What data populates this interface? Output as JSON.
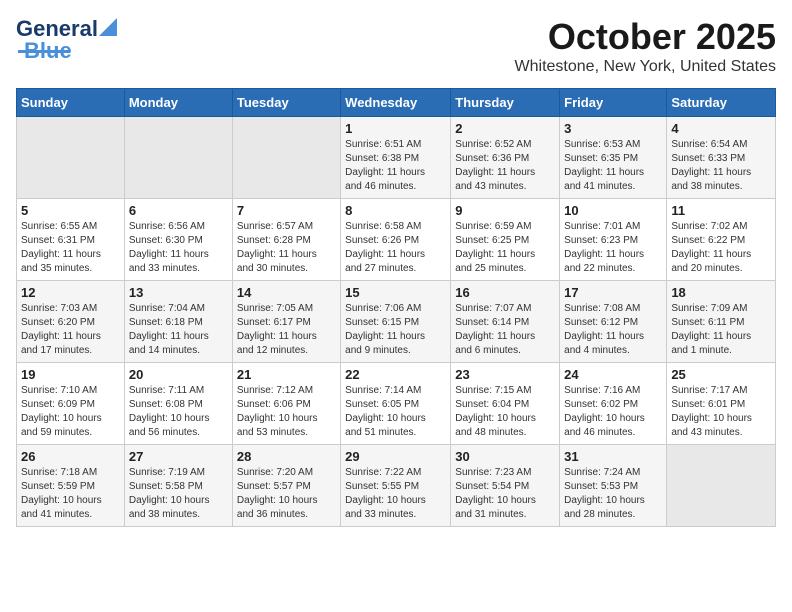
{
  "header": {
    "logo_general": "General",
    "logo_blue": "Blue",
    "month_title": "October 2025",
    "location": "Whitestone, New York, United States"
  },
  "days_of_week": [
    "Sunday",
    "Monday",
    "Tuesday",
    "Wednesday",
    "Thursday",
    "Friday",
    "Saturday"
  ],
  "weeks": [
    [
      {
        "day": "",
        "content": ""
      },
      {
        "day": "",
        "content": ""
      },
      {
        "day": "",
        "content": ""
      },
      {
        "day": "1",
        "content": "Sunrise: 6:51 AM\nSunset: 6:38 PM\nDaylight: 11 hours\nand 46 minutes."
      },
      {
        "day": "2",
        "content": "Sunrise: 6:52 AM\nSunset: 6:36 PM\nDaylight: 11 hours\nand 43 minutes."
      },
      {
        "day": "3",
        "content": "Sunrise: 6:53 AM\nSunset: 6:35 PM\nDaylight: 11 hours\nand 41 minutes."
      },
      {
        "day": "4",
        "content": "Sunrise: 6:54 AM\nSunset: 6:33 PM\nDaylight: 11 hours\nand 38 minutes."
      }
    ],
    [
      {
        "day": "5",
        "content": "Sunrise: 6:55 AM\nSunset: 6:31 PM\nDaylight: 11 hours\nand 35 minutes."
      },
      {
        "day": "6",
        "content": "Sunrise: 6:56 AM\nSunset: 6:30 PM\nDaylight: 11 hours\nand 33 minutes."
      },
      {
        "day": "7",
        "content": "Sunrise: 6:57 AM\nSunset: 6:28 PM\nDaylight: 11 hours\nand 30 minutes."
      },
      {
        "day": "8",
        "content": "Sunrise: 6:58 AM\nSunset: 6:26 PM\nDaylight: 11 hours\nand 27 minutes."
      },
      {
        "day": "9",
        "content": "Sunrise: 6:59 AM\nSunset: 6:25 PM\nDaylight: 11 hours\nand 25 minutes."
      },
      {
        "day": "10",
        "content": "Sunrise: 7:01 AM\nSunset: 6:23 PM\nDaylight: 11 hours\nand 22 minutes."
      },
      {
        "day": "11",
        "content": "Sunrise: 7:02 AM\nSunset: 6:22 PM\nDaylight: 11 hours\nand 20 minutes."
      }
    ],
    [
      {
        "day": "12",
        "content": "Sunrise: 7:03 AM\nSunset: 6:20 PM\nDaylight: 11 hours\nand 17 minutes."
      },
      {
        "day": "13",
        "content": "Sunrise: 7:04 AM\nSunset: 6:18 PM\nDaylight: 11 hours\nand 14 minutes."
      },
      {
        "day": "14",
        "content": "Sunrise: 7:05 AM\nSunset: 6:17 PM\nDaylight: 11 hours\nand 12 minutes."
      },
      {
        "day": "15",
        "content": "Sunrise: 7:06 AM\nSunset: 6:15 PM\nDaylight: 11 hours\nand 9 minutes."
      },
      {
        "day": "16",
        "content": "Sunrise: 7:07 AM\nSunset: 6:14 PM\nDaylight: 11 hours\nand 6 minutes."
      },
      {
        "day": "17",
        "content": "Sunrise: 7:08 AM\nSunset: 6:12 PM\nDaylight: 11 hours\nand 4 minutes."
      },
      {
        "day": "18",
        "content": "Sunrise: 7:09 AM\nSunset: 6:11 PM\nDaylight: 11 hours\nand 1 minute."
      }
    ],
    [
      {
        "day": "19",
        "content": "Sunrise: 7:10 AM\nSunset: 6:09 PM\nDaylight: 10 hours\nand 59 minutes."
      },
      {
        "day": "20",
        "content": "Sunrise: 7:11 AM\nSunset: 6:08 PM\nDaylight: 10 hours\nand 56 minutes."
      },
      {
        "day": "21",
        "content": "Sunrise: 7:12 AM\nSunset: 6:06 PM\nDaylight: 10 hours\nand 53 minutes."
      },
      {
        "day": "22",
        "content": "Sunrise: 7:14 AM\nSunset: 6:05 PM\nDaylight: 10 hours\nand 51 minutes."
      },
      {
        "day": "23",
        "content": "Sunrise: 7:15 AM\nSunset: 6:04 PM\nDaylight: 10 hours\nand 48 minutes."
      },
      {
        "day": "24",
        "content": "Sunrise: 7:16 AM\nSunset: 6:02 PM\nDaylight: 10 hours\nand 46 minutes."
      },
      {
        "day": "25",
        "content": "Sunrise: 7:17 AM\nSunset: 6:01 PM\nDaylight: 10 hours\nand 43 minutes."
      }
    ],
    [
      {
        "day": "26",
        "content": "Sunrise: 7:18 AM\nSunset: 5:59 PM\nDaylight: 10 hours\nand 41 minutes."
      },
      {
        "day": "27",
        "content": "Sunrise: 7:19 AM\nSunset: 5:58 PM\nDaylight: 10 hours\nand 38 minutes."
      },
      {
        "day": "28",
        "content": "Sunrise: 7:20 AM\nSunset: 5:57 PM\nDaylight: 10 hours\nand 36 minutes."
      },
      {
        "day": "29",
        "content": "Sunrise: 7:22 AM\nSunset: 5:55 PM\nDaylight: 10 hours\nand 33 minutes."
      },
      {
        "day": "30",
        "content": "Sunrise: 7:23 AM\nSunset: 5:54 PM\nDaylight: 10 hours\nand 31 minutes."
      },
      {
        "day": "31",
        "content": "Sunrise: 7:24 AM\nSunset: 5:53 PM\nDaylight: 10 hours\nand 28 minutes."
      },
      {
        "day": "",
        "content": ""
      }
    ]
  ]
}
